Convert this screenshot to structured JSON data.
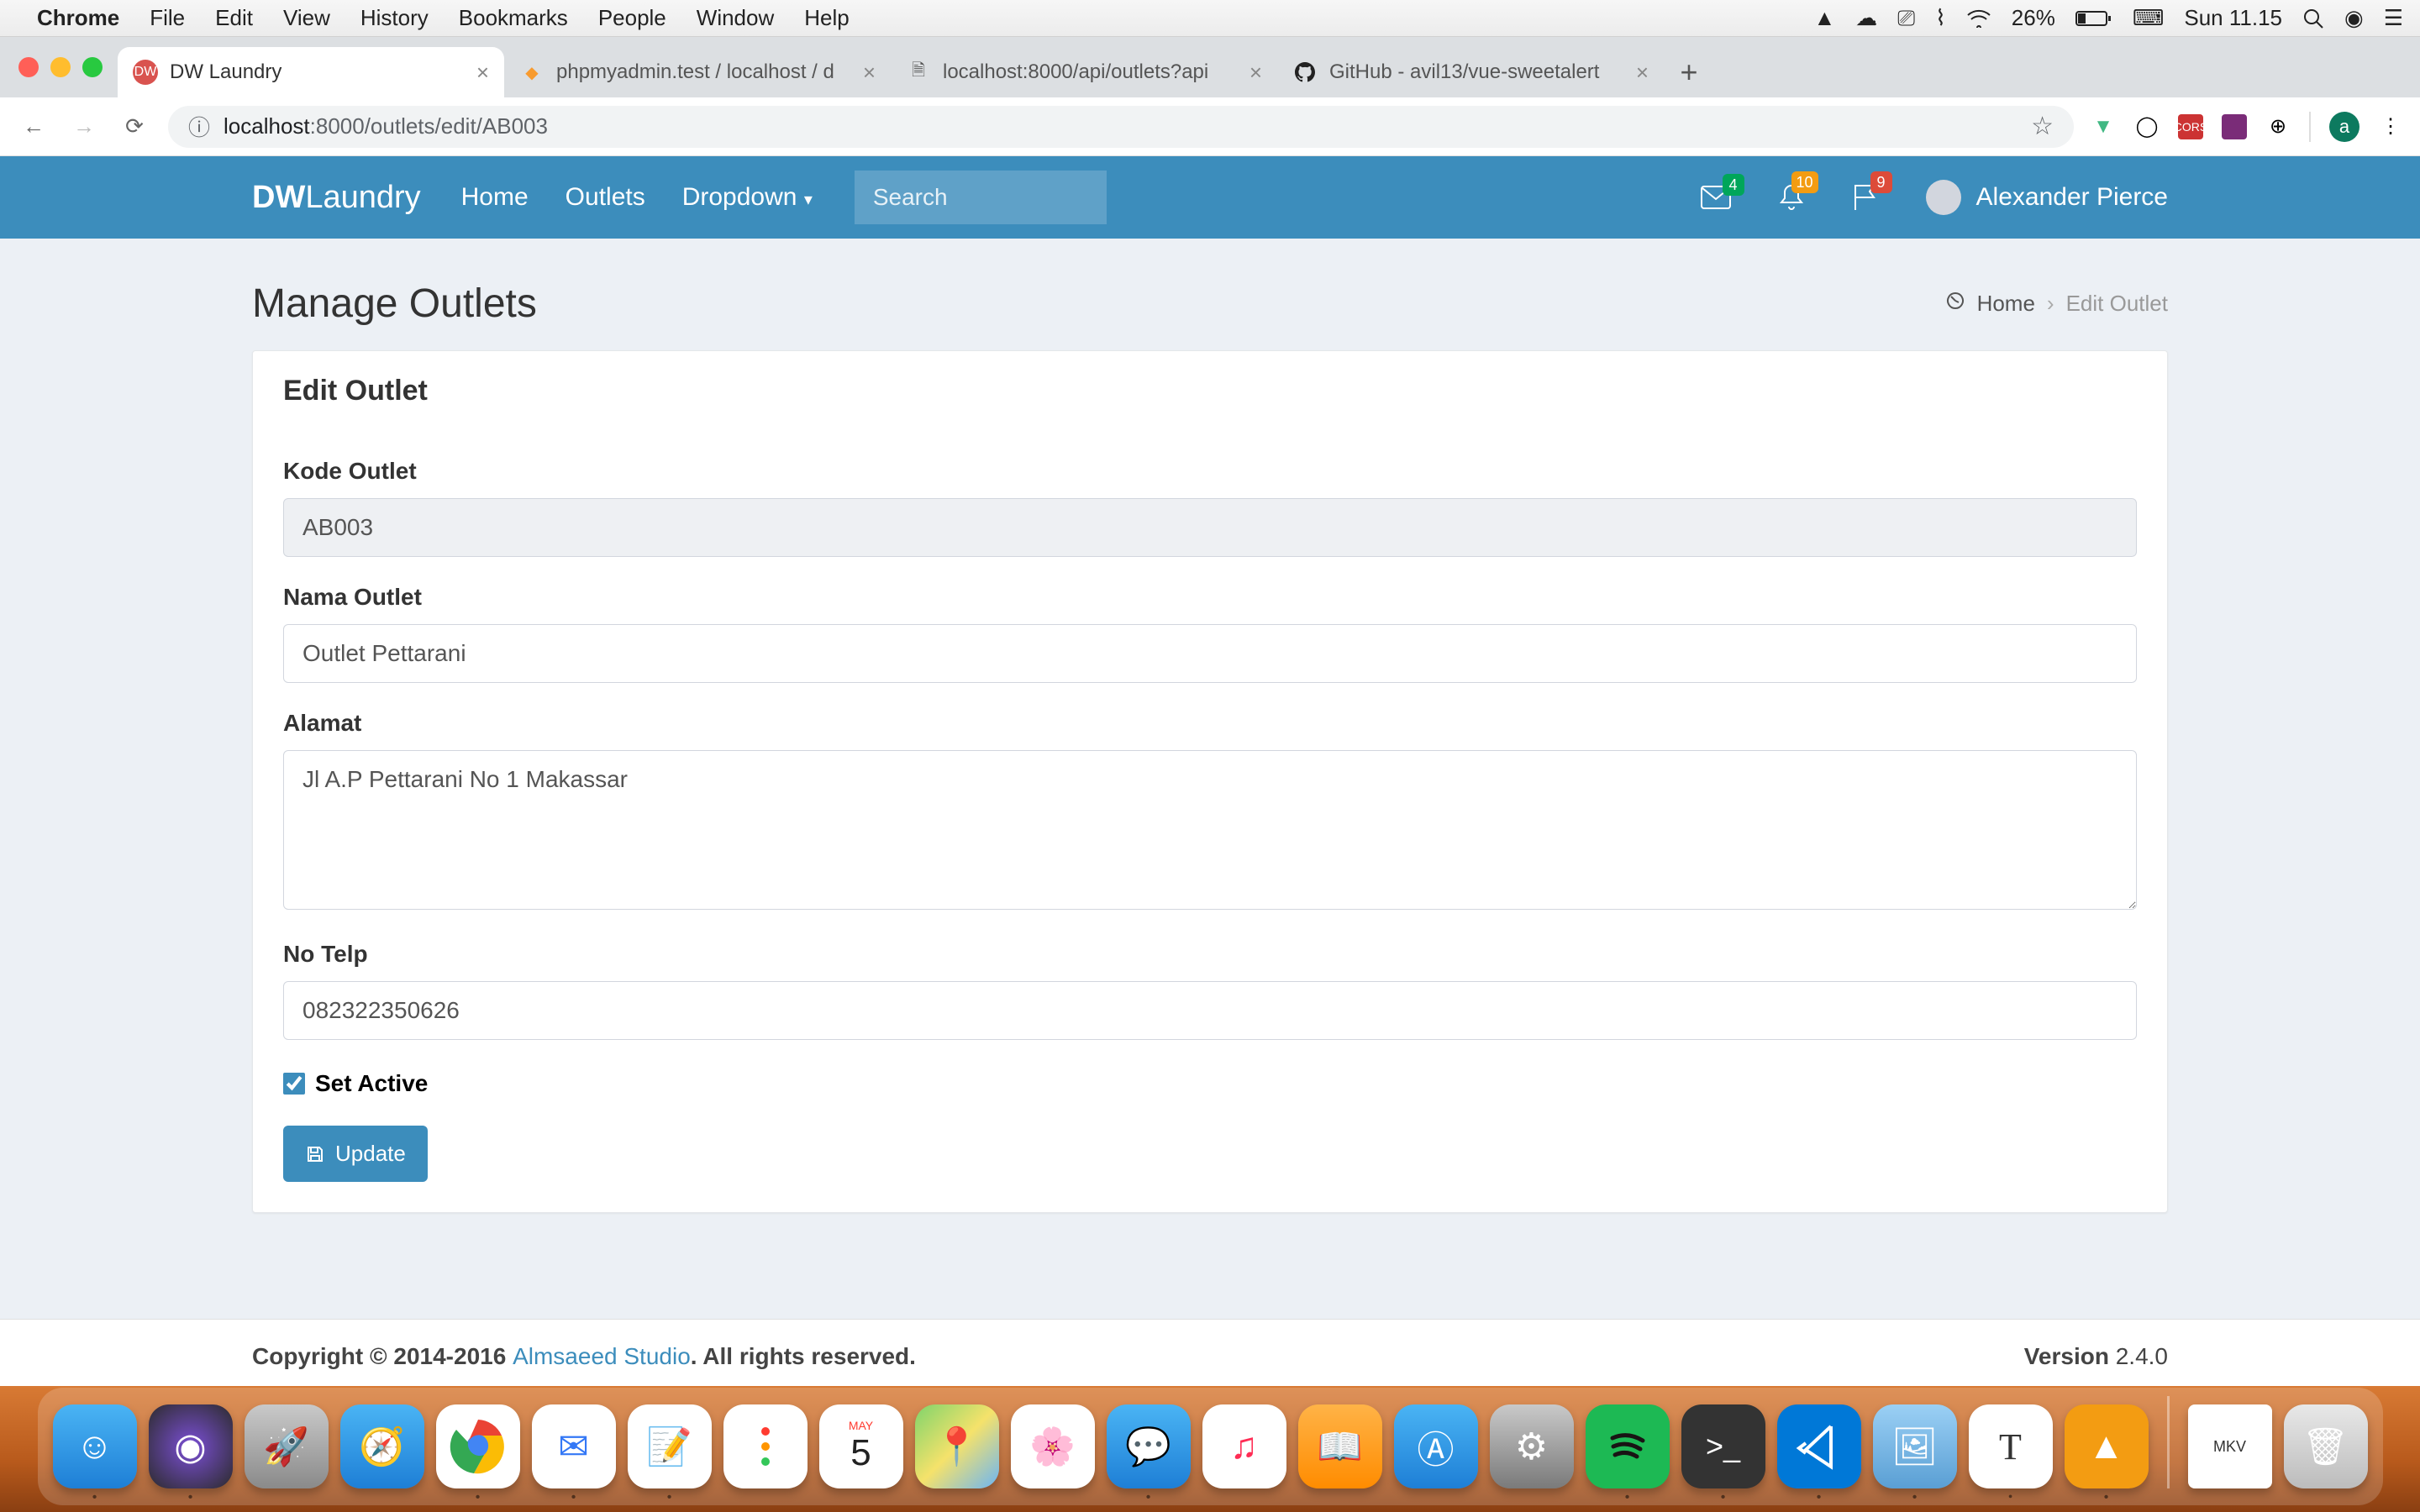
{
  "menubar": {
    "app": "Chrome",
    "items": [
      "File",
      "Edit",
      "View",
      "History",
      "Bookmarks",
      "People",
      "Window",
      "Help"
    ],
    "battery": "26%",
    "clock": "Sun 11.15"
  },
  "tabs": [
    {
      "title": "DW Laundry",
      "active": true
    },
    {
      "title": "phpmyadmin.test / localhost / d",
      "active": false
    },
    {
      "title": "localhost:8000/api/outlets?api",
      "active": false
    },
    {
      "title": "GitHub - avil13/vue-sweetalert",
      "active": false
    }
  ],
  "url": {
    "prefix": "localhost",
    "rest": ":8000/outlets/edit/AB003"
  },
  "avatar_letter": "a",
  "nav": {
    "brand_bold": "DW",
    "brand_rest": "Laundry",
    "links": [
      "Home",
      "Outlets",
      "Dropdown"
    ],
    "search_placeholder": "Search",
    "badges": {
      "mail": "4",
      "bell": "10",
      "flag": "9"
    },
    "user": "Alexander Pierce"
  },
  "page": {
    "title": "Manage Outlets",
    "breadcrumb_home": "Home",
    "breadcrumb_current": "Edit Outlet",
    "card_title": "Edit Outlet"
  },
  "form": {
    "kode_label": "Kode Outlet",
    "kode_value": "AB003",
    "nama_label": "Nama Outlet",
    "nama_value": "Outlet Pettarani",
    "alamat_label": "Alamat",
    "alamat_value": "Jl A.P Pettarani No 1 Makassar",
    "telp_label": "No Telp",
    "telp_value": "082322350626",
    "active_label": "Set Active",
    "active_checked": true,
    "submit_label": "Update"
  },
  "footer": {
    "copyright": "Copyright © 2014-2016 ",
    "link": "Almsaeed Studio",
    "rights": ". All rights reserved.",
    "version_label": "Version",
    "version": " 2.4.0"
  },
  "dock_date": "5",
  "dock_month": "MAY"
}
